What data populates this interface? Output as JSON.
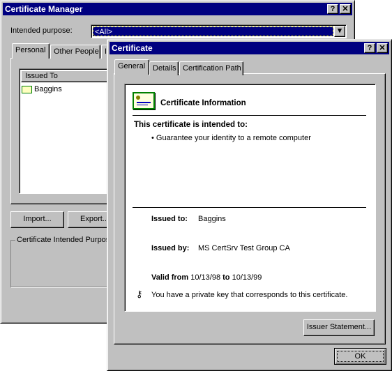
{
  "manager": {
    "title": "Certificate Manager",
    "help_button": "?",
    "close_button": "✕",
    "purpose_label": "Intended purpose:",
    "purpose_value": "<All>",
    "tabs": [
      {
        "label": "Personal"
      },
      {
        "label": "Other People"
      },
      {
        "label": "I"
      }
    ],
    "list_header": "Issued To",
    "list_items": [
      {
        "label": "Baggins"
      }
    ],
    "import_button": "Import...",
    "export_button": "Export...",
    "group_label": "Certificate Intended Purpose"
  },
  "certificate": {
    "title": "Certificate",
    "help_button": "?",
    "close_button": "✕",
    "tabs": [
      {
        "label": "General"
      },
      {
        "label": "Details"
      },
      {
        "label": "Certification Path"
      }
    ],
    "info_heading": "Certificate Information",
    "intended_heading": "This certificate is intended to:",
    "purposes": [
      "Guarantee your identity to a remote computer"
    ],
    "issued_to_label": "Issued to:",
    "issued_to_value": "Baggins",
    "issued_by_label": "Issued by:",
    "issued_by_value": "MS CertSrv Test Group CA",
    "valid_from_label": "Valid from",
    "valid_from_value": "10/13/98",
    "valid_to_label": "to",
    "valid_to_value": "10/13/99",
    "private_key_note": "You have a private key that corresponds to this certificate.",
    "issuer_statement_button": "Issuer Statement...",
    "ok_button": "OK"
  },
  "colors": {
    "titlebar": "#000080",
    "face": "#c0c0c0",
    "certificate_icon_border": "#008000"
  }
}
